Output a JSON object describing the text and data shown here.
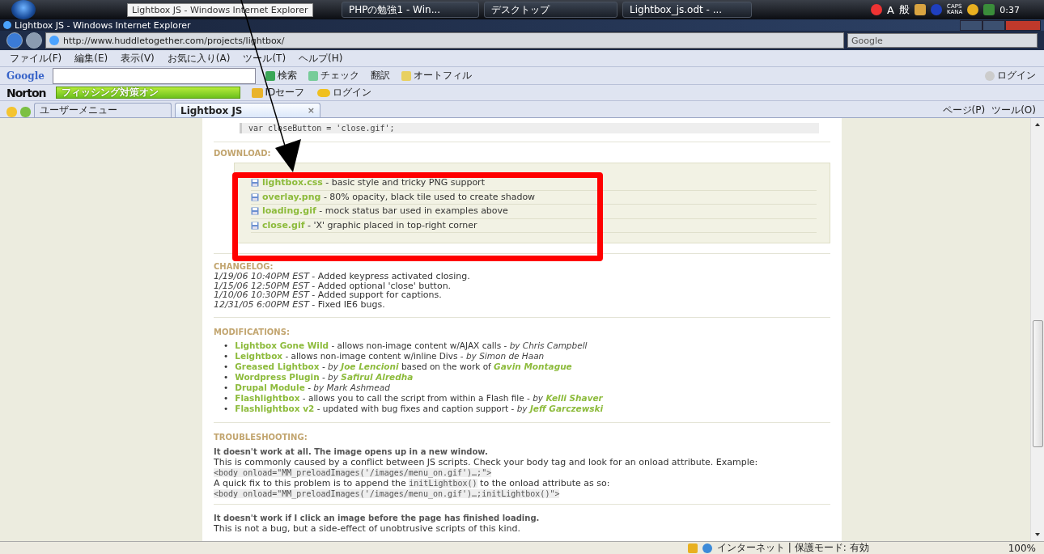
{
  "taskbar": {
    "tooltip": "Lightbox JS - Windows Internet Explorer",
    "buttons": [
      "PHPの勉強1 - Win...",
      "デスクトップ",
      "Lightbox_js.odt - ..."
    ],
    "ime": [
      "A",
      "般"
    ],
    "caps": "CAPS",
    "kana": "KANA",
    "clock": "0:37"
  },
  "window": {
    "title": "Lightbox JS - Windows Internet Explorer"
  },
  "address": {
    "url": "http://www.huddletogether.com/projects/lightbox/",
    "search_placeholder": "Google"
  },
  "menu": [
    "ファイル(F)",
    "編集(E)",
    "表示(V)",
    "お気に入り(A)",
    "ツール(T)",
    "ヘルプ(H)"
  ],
  "google_toolbar": {
    "logo": "Google",
    "search": "検索",
    "check": "チェック",
    "translate": "翻訳",
    "autofill": "オートフィル",
    "login": "ログイン"
  },
  "norton_toolbar": {
    "logo": "Norton",
    "phishing": "フィッシング対策オン",
    "idsafe": "IDセーフ",
    "login": "ログイン"
  },
  "tabs": [
    {
      "label": "ユーザーメニュー",
      "selected": false
    },
    {
      "label": "Lightbox JS",
      "selected": true,
      "close": "×"
    }
  ],
  "command_bar": {
    "page": "ページ(P)",
    "tools": "ツール(O)"
  },
  "content": {
    "code_top": "var closeButton = 'close.gif';",
    "download": {
      "heading": "DOWNLOAD:",
      "files": [
        {
          "file": "lightbox.css",
          "desc": " - basic style and tricky PNG support"
        },
        {
          "file": "overlay.png",
          "desc": " - 80% opacity, black tile used to create shadow"
        },
        {
          "file": "loading.gif",
          "desc": " - mock status bar used in examples above"
        },
        {
          "file": "close.gif",
          "desc": " - 'X' graphic placed in top-right corner"
        }
      ]
    },
    "changelog": {
      "heading": "CHANGELOG:",
      "entries": [
        {
          "date": "1/19/06 10:40PM EST",
          "text": " - Added keypress activated closing."
        },
        {
          "date": "1/15/06 12:50PM EST",
          "text": " - Added optional 'close' button."
        },
        {
          "date": "1/10/06 10:30PM EST",
          "text": " - Added support for captions."
        },
        {
          "date": "12/31/05 6:00PM EST",
          "text": " - Fixed IE6 bugs."
        }
      ]
    },
    "modifications": {
      "heading": "MODIFICATIONS:",
      "items": [
        {
          "marker": "•",
          "parts": [
            {
              "kind": "link",
              "text": "Lightbox Gone Wild"
            },
            {
              "kind": "text",
              "text": " - allows non-image content w/AJAX calls - "
            },
            {
              "kind": "by",
              "text": "by Chris Campbell"
            }
          ]
        },
        {
          "marker": "•",
          "parts": [
            {
              "kind": "link",
              "text": "Leightbox"
            },
            {
              "kind": "text",
              "text": " - allows non-image content w/inline Divs - "
            },
            {
              "kind": "by",
              "text": "by Simon de Haan"
            }
          ]
        },
        {
          "marker": "•",
          "parts": [
            {
              "kind": "link",
              "text": "Greased Lightbox"
            },
            {
              "kind": "by",
              "text": " - by "
            },
            {
              "kind": "author",
              "text": "Joe Lencioni"
            },
            {
              "kind": "text",
              "text": " based on the work of "
            },
            {
              "kind": "author",
              "text": "Gavin Montague"
            }
          ]
        },
        {
          "marker": "•",
          "parts": [
            {
              "kind": "link",
              "text": "Wordpress Plugin"
            },
            {
              "kind": "by",
              "text": " - by "
            },
            {
              "kind": "author",
              "text": "Safirul Alredha"
            }
          ]
        },
        {
          "marker": "•",
          "parts": [
            {
              "kind": "link",
              "text": "Drupal Module"
            },
            {
              "kind": "by",
              "text": " - by Mark Ashmead"
            }
          ]
        },
        {
          "marker": "•",
          "parts": [
            {
              "kind": "link",
              "text": "Flashlightbox"
            },
            {
              "kind": "text",
              "text": " - allows you to call the script from within a Flash file - "
            },
            {
              "kind": "by",
              "text": "by "
            },
            {
              "kind": "author",
              "text": "Kelli Shaver"
            }
          ]
        },
        {
          "marker": "•",
          "parts": [
            {
              "kind": "link",
              "text": "Flashlightbox v2"
            },
            {
              "kind": "text",
              "text": " - updated with bug fixes and caption support - "
            },
            {
              "kind": "by",
              "text": "by "
            },
            {
              "kind": "author",
              "text": "Jeff Garczewski"
            }
          ]
        }
      ]
    },
    "troubleshooting": {
      "heading": "TROUBLESHOOTING:",
      "blocks": [
        [
          {
            "kind": "question",
            "parts": [
              {
                "code": false,
                "text": "It doesn't work at all. The image opens up in a new window."
              }
            ]
          },
          {
            "kind": "text",
            "parts": [
              {
                "code": false,
                "text": "This is commonly caused by a conflict between JS scripts. Check your body tag and look for an onload attribute. Example:"
              }
            ]
          },
          {
            "kind": "code",
            "parts": [
              {
                "code": true,
                "text": "<body onload=\"MM_preloadImages('/images/menu_on.gif')…;\">"
              }
            ]
          },
          {
            "kind": "text",
            "parts": [
              {
                "code": false,
                "text": "A quick fix to this problem is to append the "
              },
              {
                "code": true,
                "text": "initLightbox()"
              },
              {
                "code": false,
                "text": " to the onload attribute as so:"
              }
            ]
          },
          {
            "kind": "code",
            "parts": [
              {
                "code": true,
                "text": "<body onload=\"MM_preloadImages('/images/menu_on.gif')…;initLightbox()\">"
              }
            ]
          }
        ],
        [
          {
            "kind": "question",
            "parts": [
              {
                "code": false,
                "text": "It doesn't work if I click an image before the page has finished loading."
              }
            ]
          },
          {
            "kind": "text",
            "parts": [
              {
                "code": false,
                "text": "This is not a bug, but a side-effect of unobtrusive scripts of this kind."
              }
            ]
          }
        ]
      ]
    }
  },
  "status_bar": {
    "zone": "インターネット | 保護モード: 有効",
    "zoom": "100%"
  }
}
